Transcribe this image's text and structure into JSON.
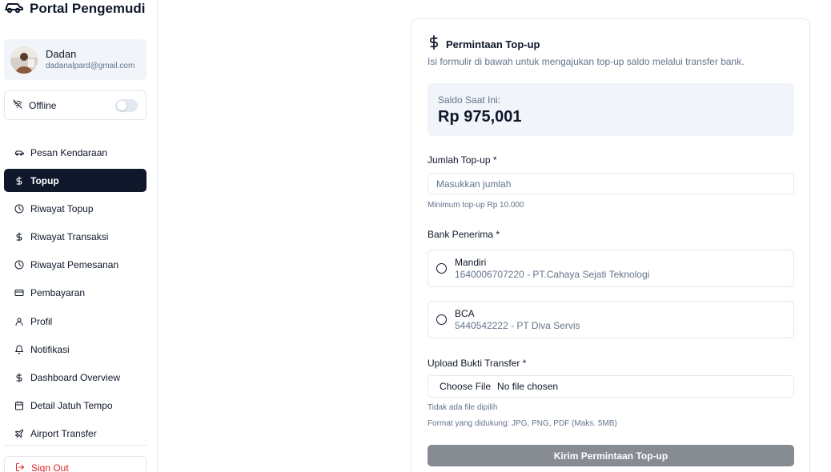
{
  "app": {
    "title": "Portal Pengemudi"
  },
  "user": {
    "name": "Dadan",
    "email": "dadanalpard@gmail.com"
  },
  "status": {
    "label": "Offline",
    "online": false
  },
  "nav": {
    "items": [
      {
        "label": "Pesan Kendaraan",
        "icon": "car-icon"
      },
      {
        "label": "Topup",
        "icon": "dollar-icon",
        "active": true
      },
      {
        "label": "Riwayat Topup",
        "icon": "clock-icon"
      },
      {
        "label": "Riwayat Transaksi",
        "icon": "dollar-icon"
      },
      {
        "label": "Riwayat Pemesanan",
        "icon": "clock-icon"
      },
      {
        "label": "Pembayaran",
        "icon": "credit-card-icon"
      },
      {
        "label": "Profil",
        "icon": "user-icon"
      },
      {
        "label": "Notifikasi",
        "icon": "bell-icon"
      },
      {
        "label": "Dashboard Overview",
        "icon": "dollar-icon"
      },
      {
        "label": "Detail Jatuh Tempo",
        "icon": "calendar-icon"
      },
      {
        "label": "Airport Transfer",
        "icon": "plane-icon"
      }
    ],
    "signout": "Sign Out"
  },
  "topup": {
    "title": "Permintaan Top-up",
    "description": "Isi formulir di bawah untuk mengajukan top-up saldo melalui transfer bank.",
    "balance_label": "Saldo Saat Ini:",
    "balance_value": "Rp 975,001",
    "amount_label": "Jumlah Top-up *",
    "amount_placeholder": "Masukkan jumlah",
    "amount_hint": "Minimum top-up Rp 10.000",
    "bank_label": "Bank Penerima *",
    "banks": [
      {
        "name": "Mandiri",
        "account": "1640006707220 - PT.Cahaya Sejati Teknologi"
      },
      {
        "name": "BCA",
        "account": "5440542222 - PT Diva Servis"
      }
    ],
    "upload_label": "Upload Bukti Transfer *",
    "file_button": "Choose File",
    "file_status": "No file chosen",
    "file_hint": "Tidak ada file dipilih",
    "format_hint": "Format yang didukung: JPG, PNG, PDF (Maks. 5MB)",
    "submit_label": "Kirim Permintaan Top-up"
  },
  "colors": {
    "primary": "#0f172a",
    "muted": "#64748b",
    "danger": "#dc2626",
    "submit_disabled": "#878c93",
    "panel": "#f1f5f9"
  }
}
